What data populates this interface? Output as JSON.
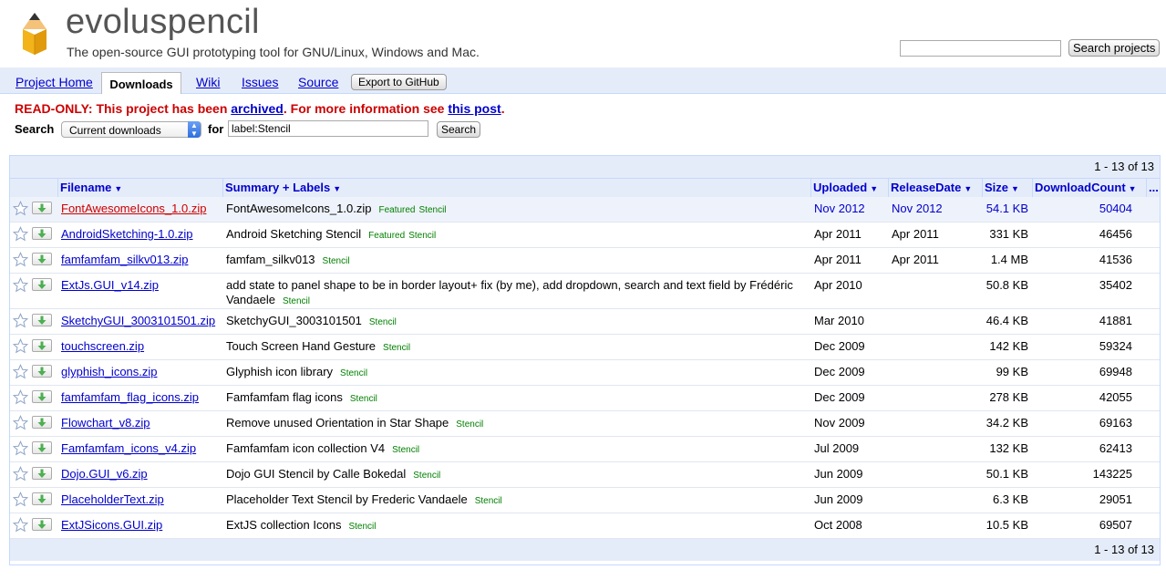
{
  "header": {
    "project_name": "evoluspencil",
    "summary": "The open-source GUI prototyping tool for GNU/Linux, Windows and Mac.",
    "search_projects_value": "",
    "search_projects_button": "Search projects"
  },
  "tabs": {
    "project_home": "Project Home",
    "downloads": "Downloads",
    "wiki": "Wiki",
    "issues": "Issues",
    "source": "Source",
    "export": "Export to GitHub"
  },
  "notice": {
    "prefix": "READ-ONLY: This project has been ",
    "archived_link": "archived",
    "middle": ". For more information see ",
    "post_link": "this post",
    "suffix": "."
  },
  "search": {
    "label": "Search",
    "select_value": "Current downloads",
    "for_label": "for",
    "query": "label:Stencil",
    "button": "Search"
  },
  "pagination": "1 - 13 of 13",
  "columns": {
    "filename": "Filename",
    "summary": "Summary + Labels",
    "uploaded": "Uploaded",
    "release_date": "ReleaseDate",
    "size": "Size",
    "download_count": "DownloadCount",
    "more": "..."
  },
  "rows": [
    {
      "file": "FontAwesomeIcons_1.0.zip",
      "summary": "FontAwesomeIcons_1.0.zip",
      "labels": [
        "Featured",
        "Stencil"
      ],
      "uploaded": "Nov 2012",
      "release": "Nov 2012",
      "size": "54.1 KB",
      "count": "50404"
    },
    {
      "file": "AndroidSketching-1.0.zip",
      "summary": "Android Sketching Stencil",
      "labels": [
        "Featured",
        "Stencil"
      ],
      "uploaded": "Apr 2011",
      "release": "Apr 2011",
      "size": "331 KB",
      "count": "46456"
    },
    {
      "file": "famfamfam_silkv013.zip",
      "summary": "famfam_silkv013",
      "labels": [
        "Stencil"
      ],
      "uploaded": "Apr 2011",
      "release": "Apr 2011",
      "size": "1.4 MB",
      "count": "41536"
    },
    {
      "file": "ExtJs.GUI_v14.zip",
      "summary": "add state to panel shape to be in border layout+ fix (by me), add dropdown, search and text field by Frédéric Vandaele",
      "labels": [
        "Stencil"
      ],
      "uploaded": "Apr 2010",
      "release": "",
      "size": "50.8 KB",
      "count": "35402"
    },
    {
      "file": "SketchyGUI_3003101501.zip",
      "summary": "SketchyGUI_3003101501",
      "labels": [
        "Stencil"
      ],
      "uploaded": "Mar 2010",
      "release": "",
      "size": "46.4 KB",
      "count": "41881"
    },
    {
      "file": "touchscreen.zip",
      "summary": "Touch Screen Hand Gesture",
      "labels": [
        "Stencil"
      ],
      "uploaded": "Dec 2009",
      "release": "",
      "size": "142 KB",
      "count": "59324"
    },
    {
      "file": "glyphish_icons.zip",
      "summary": "Glyphish icon library",
      "labels": [
        "Stencil"
      ],
      "uploaded": "Dec 2009",
      "release": "",
      "size": "99 KB",
      "count": "69948"
    },
    {
      "file": "famfamfam_flag_icons.zip",
      "summary": "Famfamfam flag icons",
      "labels": [
        "Stencil"
      ],
      "uploaded": "Dec 2009",
      "release": "",
      "size": "278 KB",
      "count": "42055"
    },
    {
      "file": "Flowchart_v8.zip",
      "summary": "Remove unused Orientation in Star Shape",
      "labels": [
        "Stencil"
      ],
      "uploaded": "Nov 2009",
      "release": "",
      "size": "34.2 KB",
      "count": "69163"
    },
    {
      "file": "Famfamfam_icons_v4.zip",
      "summary": "Famfamfam icon collection V4",
      "labels": [
        "Stencil"
      ],
      "uploaded": "Jul 2009",
      "release": "",
      "size": "132 KB",
      "count": "62413"
    },
    {
      "file": "Dojo.GUI_v6.zip",
      "summary": "Dojo GUI Stencil by Calle Bokedal",
      "labels": [
        "Stencil"
      ],
      "uploaded": "Jun 2009",
      "release": "",
      "size": "50.1 KB",
      "count": "143225"
    },
    {
      "file": "PlaceholderText.zip",
      "summary": "Placeholder Text Stencil by Frederic Vandaele",
      "labels": [
        "Stencil"
      ],
      "uploaded": "Jun 2009",
      "release": "",
      "size": "6.3 KB",
      "count": "29051"
    },
    {
      "file": "ExtJSicons.GUI.zip",
      "summary": "ExtJS collection Icons",
      "labels": [
        "Stencil"
      ],
      "uploaded": "Oct 2008",
      "release": "",
      "size": "10.5 KB",
      "count": "69507"
    }
  ]
}
